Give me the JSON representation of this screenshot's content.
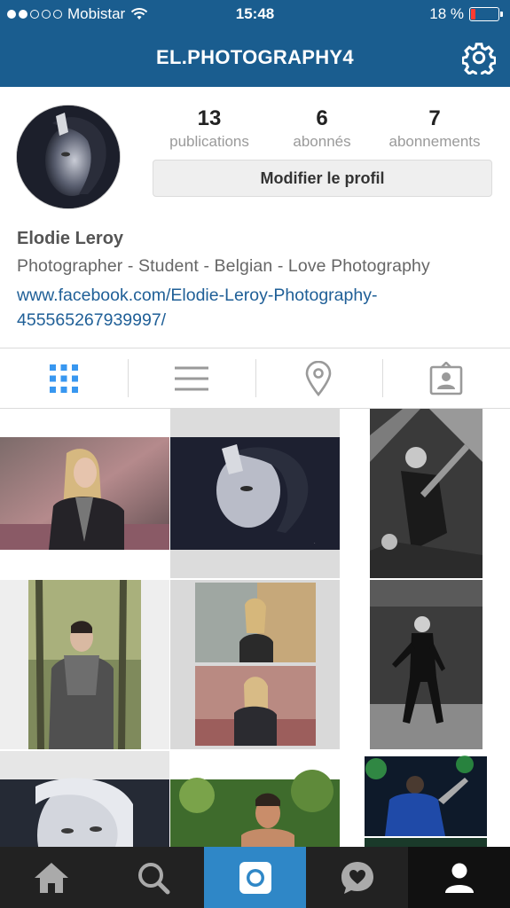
{
  "status_bar": {
    "carrier": "Mobistar",
    "time": "15:48",
    "battery": "18 %",
    "battery_level": 0.18,
    "signal_bars": 2
  },
  "header": {
    "title": "EL.PHOTOGRAPHY4",
    "settings_icon": "gear-icon"
  },
  "profile": {
    "stats": [
      {
        "value": "13",
        "label": "publications"
      },
      {
        "value": "6",
        "label": "abonnés"
      },
      {
        "value": "7",
        "label": "abonnements"
      }
    ],
    "edit_button": "Modifier le profil",
    "name": "Elodie Leroy",
    "bio": "Photographer - Student - Belgian - Love Photography",
    "link": "www.facebook.com/Elodie-Leroy-Photography-455565267939997/"
  },
  "view_tabs": [
    {
      "icon": "grid-icon",
      "active": true
    },
    {
      "icon": "list-icon",
      "active": false
    },
    {
      "icon": "location-pin-icon",
      "active": false
    },
    {
      "icon": "tagged-person-icon",
      "active": false
    }
  ],
  "tab_bar": [
    {
      "icon": "home-icon"
    },
    {
      "icon": "search-icon"
    },
    {
      "icon": "camera-icon",
      "active": true
    },
    {
      "icon": "activity-heart-icon"
    },
    {
      "icon": "profile-icon"
    }
  ],
  "colors": {
    "brand_blue": "#1a5d8f",
    "link_blue": "#1f5f97",
    "active_tab": "#2f87c7",
    "grid_active": "#3897f0"
  }
}
